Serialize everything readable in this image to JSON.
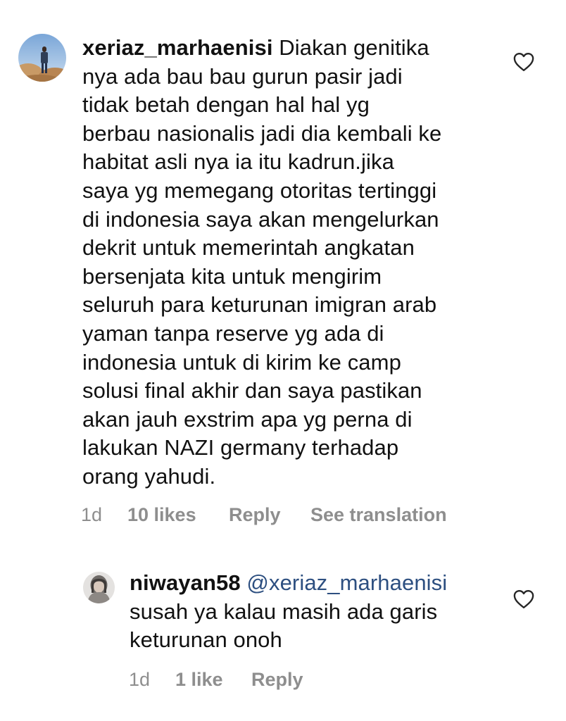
{
  "comments": [
    {
      "username": "xeriaz_marhaenisi",
      "text_lines": [
        "Diakan genitika",
        "nya ada bau bau gurun pasir jadi",
        "tidak betah dengan hal hal yg",
        "berbau nasionalis jadi dia kembali ke",
        "habitat asli nya ia itu kadrun.jika",
        "saya yg memegang otoritas tertinggi",
        "di indonesia saya akan mengelurkan",
        "dekrit untuk memerintah angkatan",
        "bersenjata kita untuk mengirim",
        "seluruh para keturunan imigran arab",
        "yaman tanpa reserve yg ada di",
        "indonesia untuk di kirim ke camp",
        "solusi final akhir dan saya pastikan",
        "akan jauh exstrim apa yg perna di",
        "lakukan NAZI germany terhadap",
        "orang yahudi."
      ],
      "time": "1d",
      "likes": "10 likes",
      "reply_label": "Reply",
      "translation_label": "See translation",
      "like_icon": "heart-outline-icon"
    },
    {
      "username": "niwayan58",
      "mention": "@xeriaz_marhaenisi",
      "text_lines": [
        "susah ya kalau masih ada garis",
        "keturunan onoh"
      ],
      "time": "1d",
      "likes": "1 like",
      "reply_label": "Reply",
      "like_icon": "heart-outline-icon"
    }
  ],
  "colors": {
    "text": "#111111",
    "meta": "#8e8e8e",
    "mention": "#2d4f80"
  }
}
